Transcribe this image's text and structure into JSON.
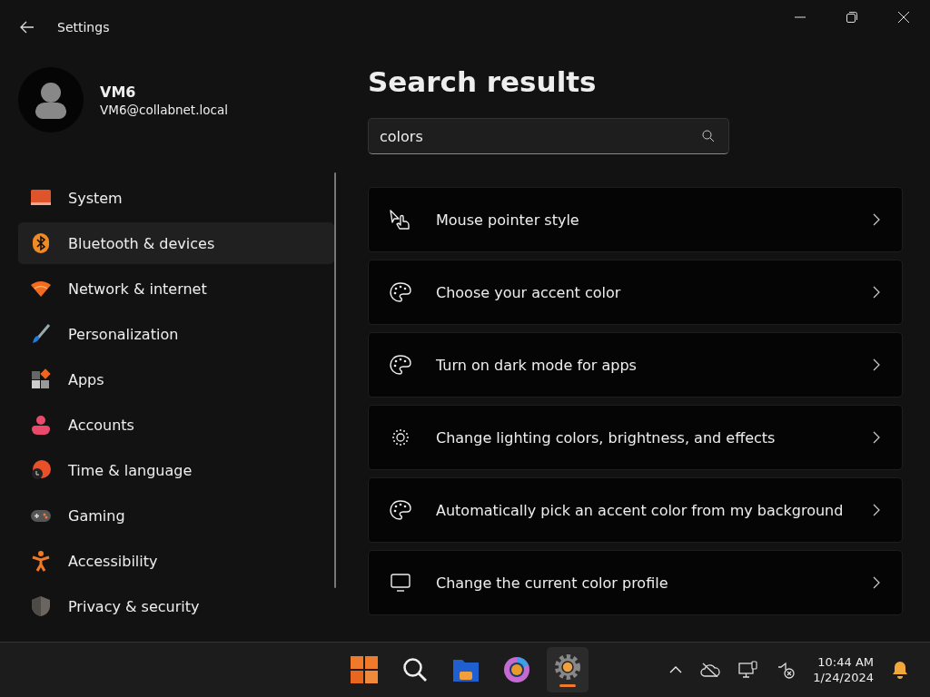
{
  "window": {
    "title": "Settings"
  },
  "profile": {
    "name": "VM6",
    "email": "VM6@collabnet.local"
  },
  "sidebar": {
    "items": [
      {
        "label": "System",
        "highlighted": false
      },
      {
        "label": "Bluetooth & devices",
        "highlighted": true
      },
      {
        "label": "Network & internet",
        "highlighted": false
      },
      {
        "label": "Personalization",
        "highlighted": false
      },
      {
        "label": "Apps",
        "highlighted": false
      },
      {
        "label": "Accounts",
        "highlighted": false
      },
      {
        "label": "Time & language",
        "highlighted": false
      },
      {
        "label": "Gaming",
        "highlighted": false
      },
      {
        "label": "Accessibility",
        "highlighted": false
      },
      {
        "label": "Privacy & security",
        "highlighted": false
      }
    ]
  },
  "page": {
    "title": "Search results",
    "search": {
      "value": "colors"
    }
  },
  "results": [
    {
      "label": "Mouse pointer style"
    },
    {
      "label": "Choose your accent color"
    },
    {
      "label": "Turn on dark mode for apps"
    },
    {
      "label": "Change lighting colors, brightness, and effects"
    },
    {
      "label": "Automatically pick an accent color from my background"
    },
    {
      "label": "Change the current color profile"
    }
  ],
  "taskbar": {
    "apps": [
      {
        "active": false
      },
      {
        "active": false
      },
      {
        "active": false
      },
      {
        "active": false
      },
      {
        "active": true
      }
    ],
    "time": "10:44 AM",
    "date": "1/24/2024"
  }
}
